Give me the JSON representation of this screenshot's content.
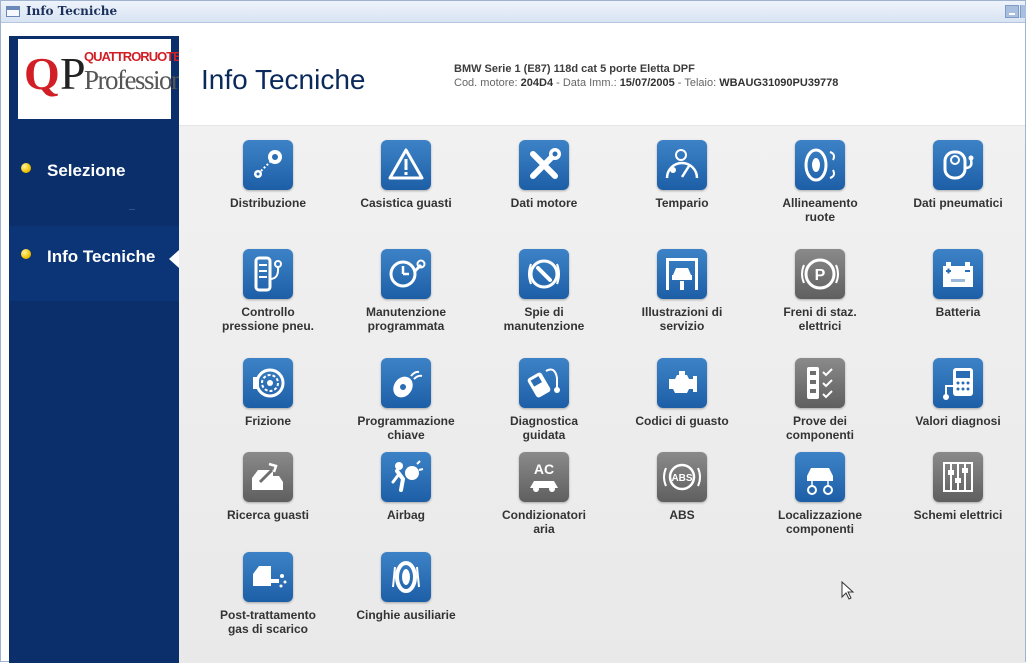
{
  "window": {
    "title": "Info Tecniche"
  },
  "logo": {
    "q": "Q",
    "p": "P",
    "brand": "QUATTRORUOTE",
    "sub": "Professional"
  },
  "sidebar": {
    "items": [
      {
        "label": "Selezione"
      },
      {
        "label": "Info Tecniche"
      }
    ]
  },
  "header": {
    "title": "Info Tecniche",
    "vehicle": "BMW Serie 1 (E87) 118d cat 5 porte Eletta DPF",
    "codes_prefix": "Cod. motore: ",
    "engine_code": "204D4",
    "codes_mid": " - Data Imm.: ",
    "reg_date": "15/07/2005",
    "codes_mid2": " - Telaio: ",
    "vin": "WBAUG31090PU39778"
  },
  "tiles": [
    {
      "l1": "Distribuzione",
      "l2": "",
      "icon": "timing-icon"
    },
    {
      "l1": "Casistica guasti",
      "l2": "",
      "icon": "warning-icon"
    },
    {
      "l1": "Dati motore",
      "l2": "",
      "icon": "tools-icon"
    },
    {
      "l1": "Tempario",
      "l2": "",
      "icon": "stopwatch-icon"
    },
    {
      "l1": "Allineamento",
      "l2": "ruote",
      "icon": "wheel-alignment-icon"
    },
    {
      "l1": "Dati pneumatici",
      "l2": "",
      "icon": "tyre-gauge-icon"
    },
    {
      "l1": "Controllo",
      "l2": "pressione pneu.",
      "icon": "tyre-pressure-icon"
    },
    {
      "l1": "Manutenzione",
      "l2": "programmata",
      "icon": "scheduled-service-icon"
    },
    {
      "l1": "Spie di",
      "l2": "manutenzione",
      "icon": "service-light-icon"
    },
    {
      "l1": "Illustrazioni di",
      "l2": "servizio",
      "icon": "lift-icon"
    },
    {
      "l1": "Freni di staz.",
      "l2": "elettrici",
      "icon": "parking-brake-icon"
    },
    {
      "l1": "Batteria",
      "l2": "",
      "icon": "battery-icon"
    },
    {
      "l1": "Frizione",
      "l2": "",
      "icon": "clutch-icon"
    },
    {
      "l1": "Programmazione",
      "l2": "chiave",
      "icon": "key-icon"
    },
    {
      "l1": "Diagnostica",
      "l2": "guidata",
      "icon": "diagnostic-tool-icon"
    },
    {
      "l1": "Codici di guasto",
      "l2": "",
      "icon": "engine-fault-icon"
    },
    {
      "l1": "Prove dei",
      "l2": "componenti",
      "icon": "component-test-icon"
    },
    {
      "l1": "Valori diagnosi",
      "l2": "",
      "icon": "diagnostic-values-icon"
    },
    {
      "l1": "Ricerca guasti",
      "l2": "",
      "icon": "troubleshooting-icon"
    },
    {
      "l1": "Airbag",
      "l2": "",
      "icon": "airbag-icon"
    },
    {
      "l1": "Condizionatori",
      "l2": "aria",
      "icon": "ac-icon"
    },
    {
      "l1": "ABS",
      "l2": "",
      "icon": "abs-icon"
    },
    {
      "l1": "Localizzazione",
      "l2": "componenti",
      "icon": "car-location-icon"
    },
    {
      "l1": "Schemi elettrici",
      "l2": "",
      "icon": "wiring-icon"
    },
    {
      "l1": "Post-trattamento",
      "l2": "gas di scarico",
      "icon": "exhaust-icon"
    },
    {
      "l1": "Cinghie ausiliarie",
      "l2": "",
      "icon": "belt-icon"
    }
  ],
  "icons": {
    "ac_text": "AC",
    "abs_text": "ABS",
    "p_text": "P"
  },
  "colors": {
    "sidebar": "#0a2f6b",
    "tile_blue": "#2a6db5",
    "tile_grey": "#6e6e6e",
    "accent_red": "#d21f26"
  }
}
